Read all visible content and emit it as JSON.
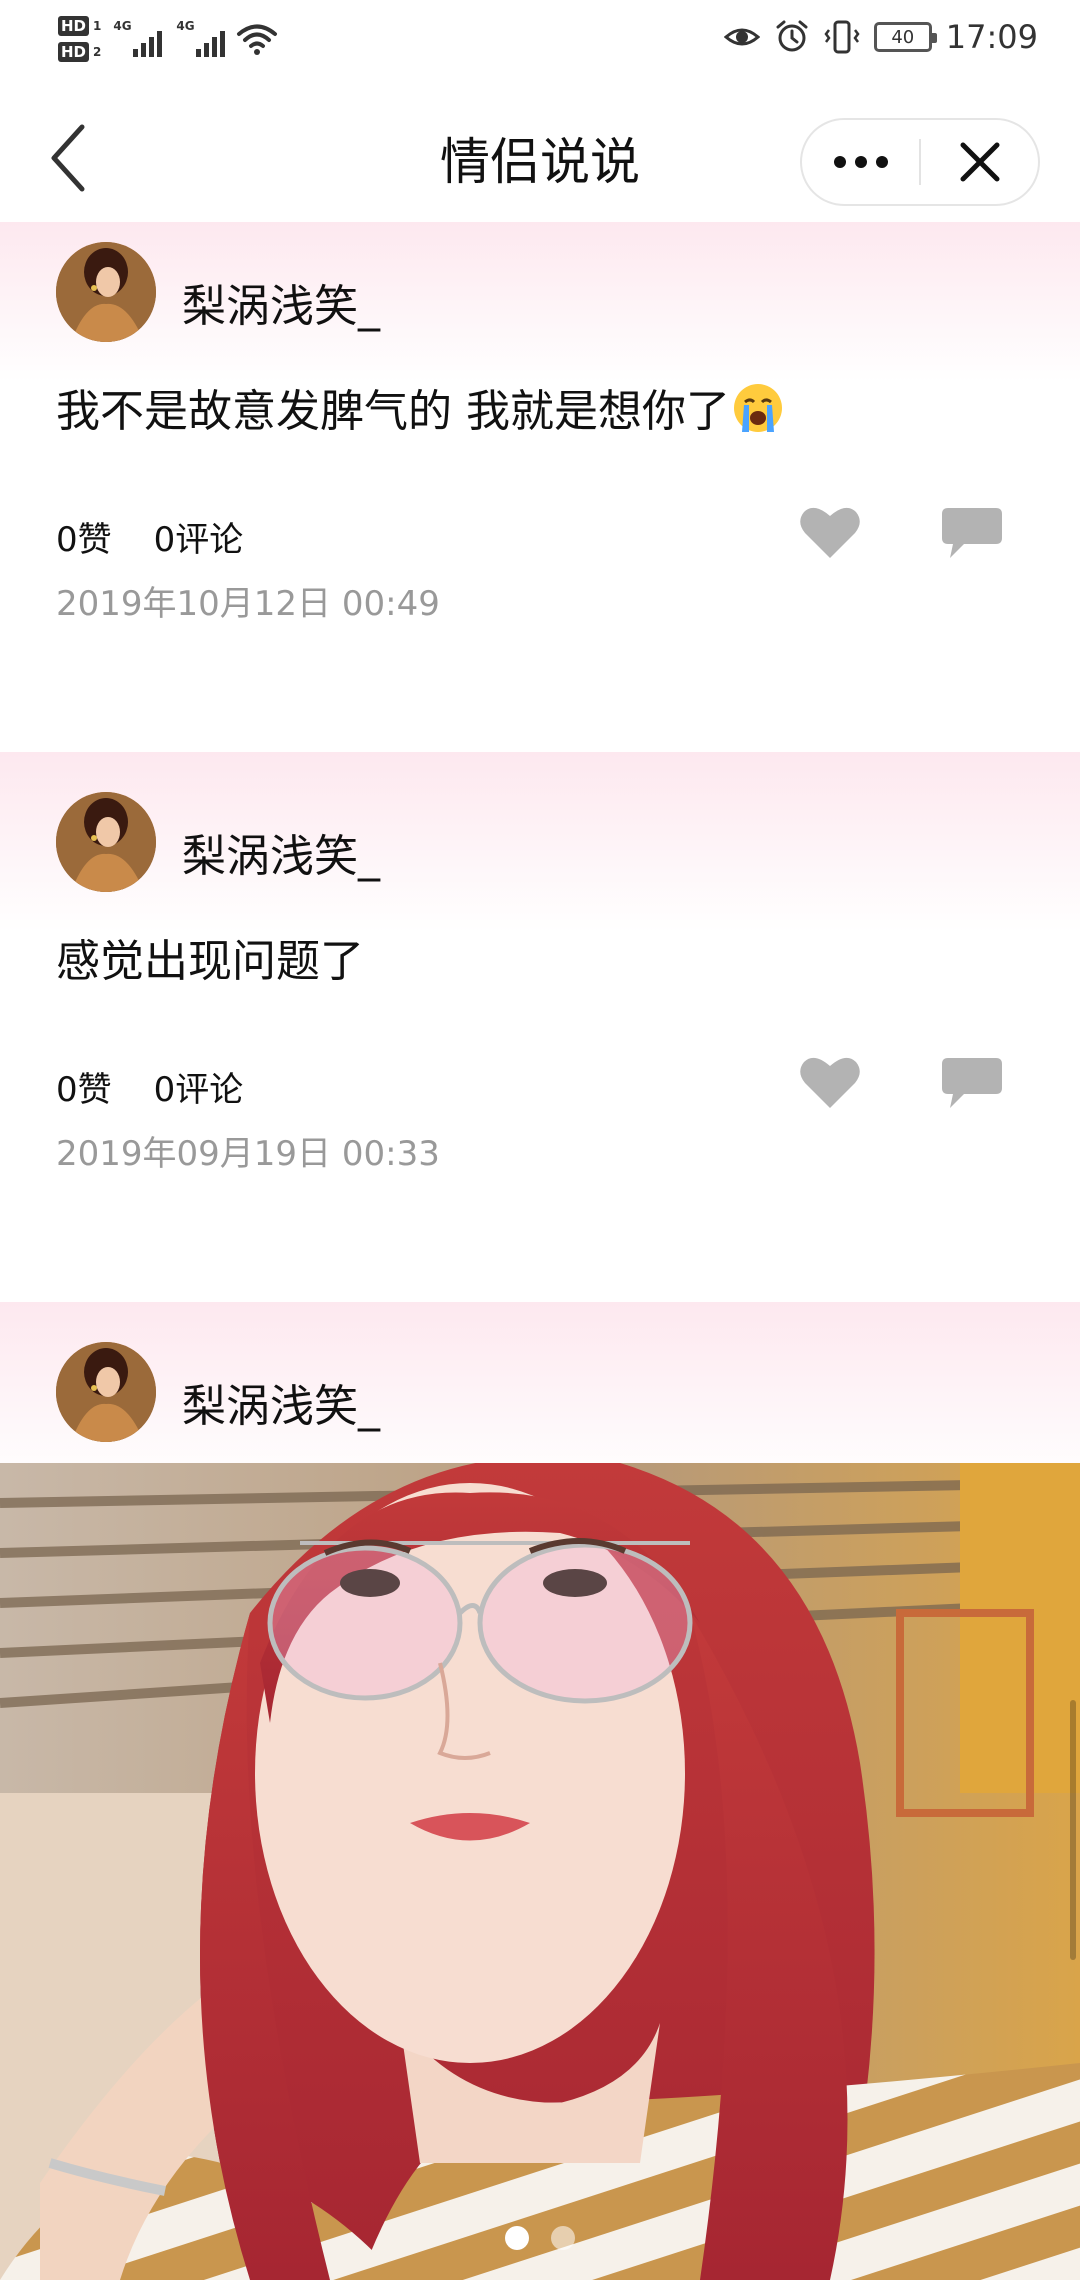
{
  "status_bar": {
    "sim1": "HD",
    "sim1_slot": "1",
    "sim2": "HD",
    "sim2_slot": "2",
    "network1": "4G",
    "network2": "4G",
    "battery": "40",
    "time": "17:09",
    "icons": [
      "eye-icon",
      "alarm-icon",
      "vibrate-icon",
      "wifi-icon"
    ]
  },
  "navbar": {
    "title": "情侣说说",
    "back_icon": "chevron-left-icon",
    "more_icon": "more-dots-icon",
    "close_icon": "close-icon"
  },
  "posts": [
    {
      "author": "梨涡浅笑_",
      "text": "我不是故意发脾气的 我就是想你了",
      "emoji": "crying-face",
      "likes": "0赞",
      "comments": "0评论",
      "date": "2019年10月12日 00:49"
    },
    {
      "author": "梨涡浅笑_",
      "text": "感觉出现问题了",
      "likes": "0赞",
      "comments": "0评论",
      "date": "2019年09月19日 00:33"
    },
    {
      "author": "梨涡浅笑_",
      "photo": "selfie-photo",
      "carousel_pages": 2,
      "carousel_active": 1
    }
  ],
  "colors": {
    "header_gradient_top": "#fde8ef",
    "icon_gray": "#b3b3b3",
    "date_gray": "#999999"
  }
}
